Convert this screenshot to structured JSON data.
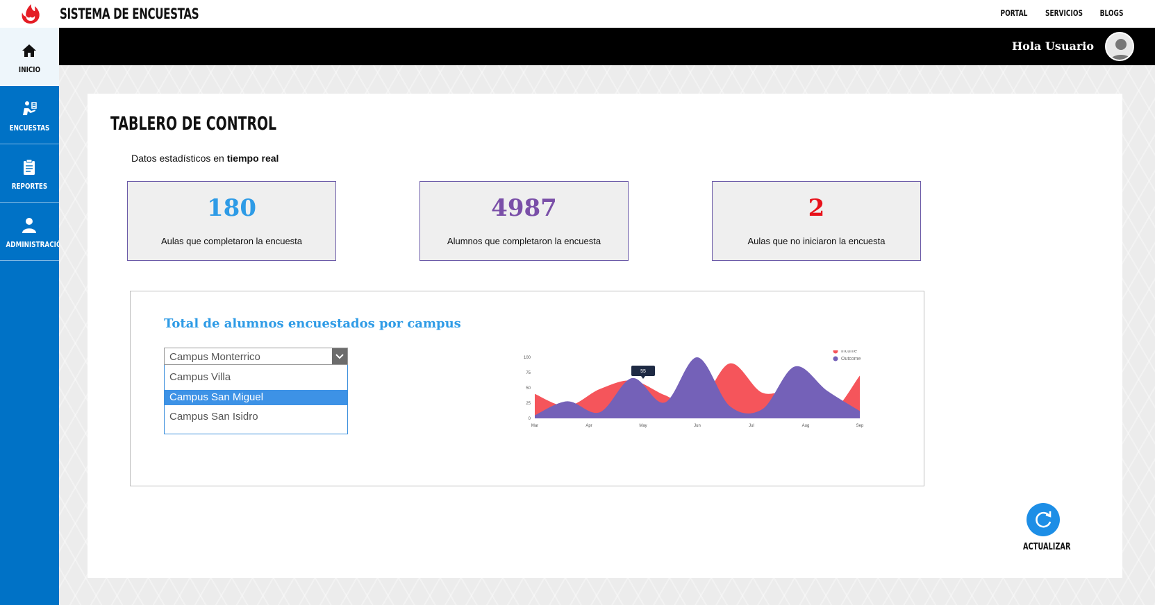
{
  "header": {
    "app_title": "SISTEMA DE ENCUESTAS",
    "links": [
      "PORTAL",
      "SERVICIOS",
      "BLOGS"
    ],
    "greeting": "Hola Usuario"
  },
  "sidebar": {
    "items": [
      {
        "label": "INICIO",
        "icon": "home-icon",
        "active": true
      },
      {
        "label": "ENCUESTAS",
        "icon": "survey-icon",
        "active": false
      },
      {
        "label": "REPORTES",
        "icon": "clipboard-icon",
        "active": false
      },
      {
        "label": "ADMINISTRACIÓN",
        "icon": "admin-user-icon",
        "active": false
      }
    ]
  },
  "main": {
    "title": "TABLERO DE CONTROL",
    "subtitle_prefix": "Datos estadísticos en ",
    "subtitle_bold": "tiempo real",
    "stats": [
      {
        "value": "180",
        "caption": "Aulas que completaron la encuesta",
        "color": "#2e9be6"
      },
      {
        "value": "4987",
        "caption": "Alumnos que completaron la encuesta",
        "color": "#7a4fa8"
      },
      {
        "value": "2",
        "caption": "Aulas que no iniciaron la encuesta",
        "color": "#e8121b"
      }
    ],
    "chart_title": "Total de alumnos encuestados por campus",
    "campus_select": {
      "selected": "Campus Monterrico",
      "options": [
        "Campus Villa",
        "Campus San Miguel",
        "Campus San Isidro"
      ],
      "highlighted": "Campus San Miguel"
    },
    "refresh_label": "ACTUALIZAR"
  },
  "chart_data": {
    "type": "area",
    "x": [
      "Mar",
      "Apr",
      "May",
      "Jun",
      "Jul",
      "Aug",
      "Sep"
    ],
    "y_ticks": [
      0,
      25,
      50,
      75,
      100
    ],
    "ylim": [
      0,
      100
    ],
    "tooltip": {
      "x": "May",
      "label": "55"
    },
    "series": [
      {
        "name": "Income",
        "color": "#f5555b",
        "values": [
          40,
          20,
          48,
          62,
          38,
          20,
          90,
          42,
          45,
          5,
          70
        ]
      },
      {
        "name": "Outcome",
        "color": "#7461b8",
        "values": [
          5,
          28,
          10,
          66,
          26,
          100,
          20,
          15,
          85,
          45,
          12
        ]
      }
    ],
    "legend": "top-right"
  }
}
